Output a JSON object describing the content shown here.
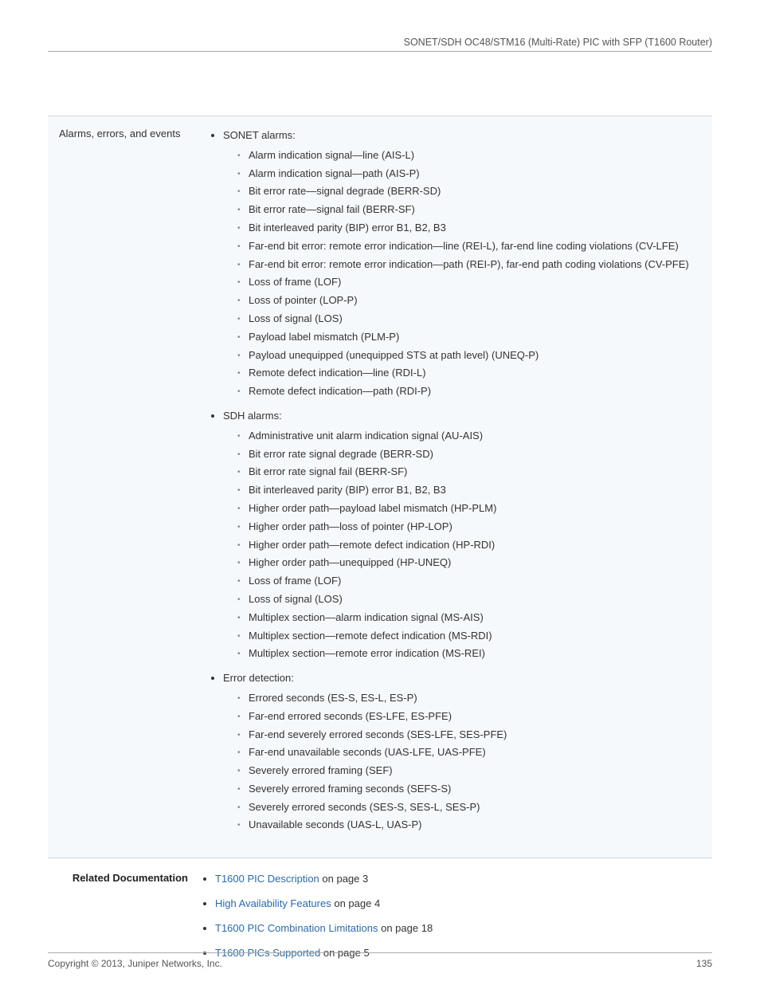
{
  "header": {
    "running_title": "SONET/SDH OC48/STM16 (Multi-Rate) PIC with SFP (T1600 Router)"
  },
  "spec": {
    "label": "Alarms, errors, and events",
    "groups": [
      {
        "title": "SONET alarms:",
        "items": [
          "Alarm indication signal—line (AIS-L)",
          "Alarm indication signal—path (AIS-P)",
          "Bit error rate—signal degrade (BERR-SD)",
          "Bit error rate—signal fail (BERR-SF)",
          "Bit interleaved parity (BIP) error B1, B2, B3",
          "Far-end bit error: remote error indication—line (REI-L), far-end line coding violations (CV-LFE)",
          "Far-end bit error: remote error indication—path (REI-P), far-end path coding violations (CV-PFE)",
          "Loss of frame (LOF)",
          "Loss of pointer (LOP-P)",
          "Loss of signal (LOS)",
          "Payload label mismatch (PLM-P)",
          "Payload unequipped (unequipped STS at path level) (UNEQ-P)",
          "Remote defect indication—line (RDI-L)",
          "Remote defect indication—path (RDI-P)"
        ]
      },
      {
        "title": "SDH alarms:",
        "items": [
          "Administrative unit alarm indication signal (AU-AIS)",
          "Bit error rate signal degrade (BERR-SD)",
          "Bit error rate signal fail (BERR-SF)",
          "Bit interleaved parity (BIP) error B1, B2, B3",
          "Higher order path—payload label mismatch (HP-PLM)",
          "Higher order path—loss of pointer (HP-LOP)",
          "Higher order path—remote defect indication (HP-RDI)",
          "Higher order path—unequipped (HP-UNEQ)",
          "Loss of frame (LOF)",
          "Loss of signal (LOS)",
          "Multiplex section—alarm indication signal (MS-AIS)",
          "Multiplex section—remote defect indication (MS-RDI)",
          "Multiplex section—remote error indication (MS-REI)"
        ]
      },
      {
        "title": "Error detection:",
        "items": [
          "Errored seconds (ES-S, ES-L, ES-P)",
          "Far-end errored seconds (ES-LFE, ES-PFE)",
          "Far-end severely errored seconds (SES-LFE, SES-PFE)",
          "Far-end unavailable seconds (UAS-LFE, UAS-PFE)",
          "Severely errored framing (SEF)",
          "Severely errored framing seconds (SEFS-S)",
          "Severely errored seconds (SES-S, SES-L, SES-P)",
          "Unavailable seconds (UAS-L, UAS-P)"
        ]
      }
    ]
  },
  "related": {
    "label": "Related Documentation",
    "items": [
      {
        "link": "T1600 PIC Description",
        "suffix": " on page 3"
      },
      {
        "link": "High Availability Features",
        "suffix": " on page 4"
      },
      {
        "link": "T1600 PIC Combination Limitations",
        "suffix": " on page 18"
      },
      {
        "link": "T1600 PICs Supported",
        "suffix": " on page 5"
      }
    ]
  },
  "footer": {
    "copyright": "Copyright © 2013, Juniper Networks, Inc.",
    "page": "135"
  }
}
